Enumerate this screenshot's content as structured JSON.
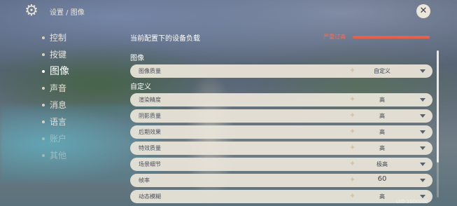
{
  "breadcrumb": "设置 / 图像",
  "sidebar": {
    "items": [
      {
        "label": "控制"
      },
      {
        "label": "按键"
      },
      {
        "label": "图像"
      },
      {
        "label": "声音"
      },
      {
        "label": "消息"
      },
      {
        "label": "语言"
      },
      {
        "label": "账户"
      },
      {
        "label": "其他"
      }
    ]
  },
  "device_load": {
    "title": "当前配置下的设备负载",
    "status": "严重过高",
    "status_color": "#e8604a"
  },
  "sections": {
    "image": "图像",
    "custom": "自定义"
  },
  "image_quality": {
    "label": "图像质量",
    "value": "自定义"
  },
  "settings": [
    {
      "label": "渲染精度",
      "value": "高"
    },
    {
      "label": "阴影质量",
      "value": "高"
    },
    {
      "label": "后期效果",
      "value": "高"
    },
    {
      "label": "特效质量",
      "value": "高"
    },
    {
      "label": "场景细节",
      "value": "极高"
    },
    {
      "label": "帧率",
      "value": "60"
    },
    {
      "label": "动态模糊",
      "value": "高"
    }
  ],
  "uid_text": "UID 1000000",
  "icons": {
    "settings": "gear-icon",
    "close": "close-icon",
    "dropdown": "chevron-down-icon"
  }
}
